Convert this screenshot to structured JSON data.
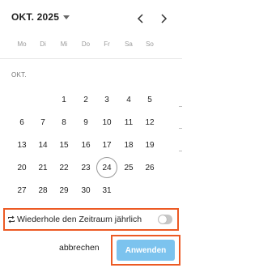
{
  "header": {
    "month_label": "OKT. 2025"
  },
  "weekdays": [
    "Mo",
    "Di",
    "Mi",
    "Do",
    "Fr",
    "Sa",
    "So"
  ],
  "calendar": {
    "month_name": "OKT.",
    "today": "24",
    "weeks": [
      [
        "",
        "",
        "1",
        "2",
        "3",
        "4",
        "5"
      ],
      [
        "6",
        "7",
        "8",
        "9",
        "10",
        "11",
        "12"
      ],
      [
        "13",
        "14",
        "15",
        "16",
        "17",
        "18",
        "19"
      ],
      [
        "20",
        "21",
        "22",
        "23",
        "24",
        "25",
        "26"
      ],
      [
        "27",
        "28",
        "29",
        "30",
        "31",
        "",
        ""
      ]
    ]
  },
  "repeat": {
    "label": "Wiederhole den Zeitraum jährlich",
    "enabled": false
  },
  "footer": {
    "cancel_label": "abbrechen",
    "apply_label": "Anwenden"
  },
  "colors": {
    "highlight_border": "#ec5a24",
    "apply_button": "#7cc3ee",
    "toggle_off": "#c7c7c7"
  }
}
